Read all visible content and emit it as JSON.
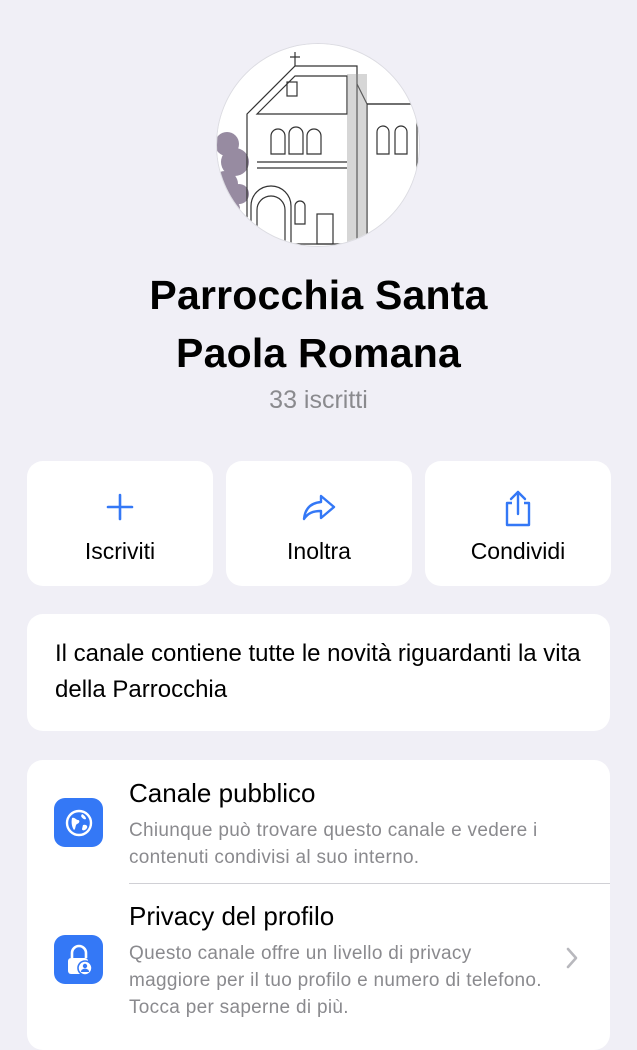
{
  "channel": {
    "name_line1": "Parrocchia Santa",
    "name_line2": "Paola Romana",
    "subscribers": "33 iscritti",
    "avatar_icon": "church-sketch-photo",
    "description": "Il canale contiene tutte le novità riguardanti la vita della Parrocchia"
  },
  "actions": [
    {
      "label": "Iscriviti",
      "icon": "plus-icon"
    },
    {
      "label": "Inoltra",
      "icon": "forward-arrow-icon"
    },
    {
      "label": "Condividi",
      "icon": "share-icon"
    }
  ],
  "info": {
    "public": {
      "title": "Canale pubblico",
      "subtitle": "Chiunque può trovare questo canale e vedere i contenuti condivisi al suo interno.",
      "icon": "globe-icon"
    },
    "privacy": {
      "title": "Privacy del profilo",
      "subtitle": "Questo canale offre un livello di privacy maggiore per il tuo profilo e numero di telefono. Tocca per saperne di più.",
      "icon": "lock-person-icon"
    }
  },
  "colors": {
    "accent": "#3478f6",
    "background": "#f0eff6",
    "secondary_text": "#8a8a8e"
  }
}
